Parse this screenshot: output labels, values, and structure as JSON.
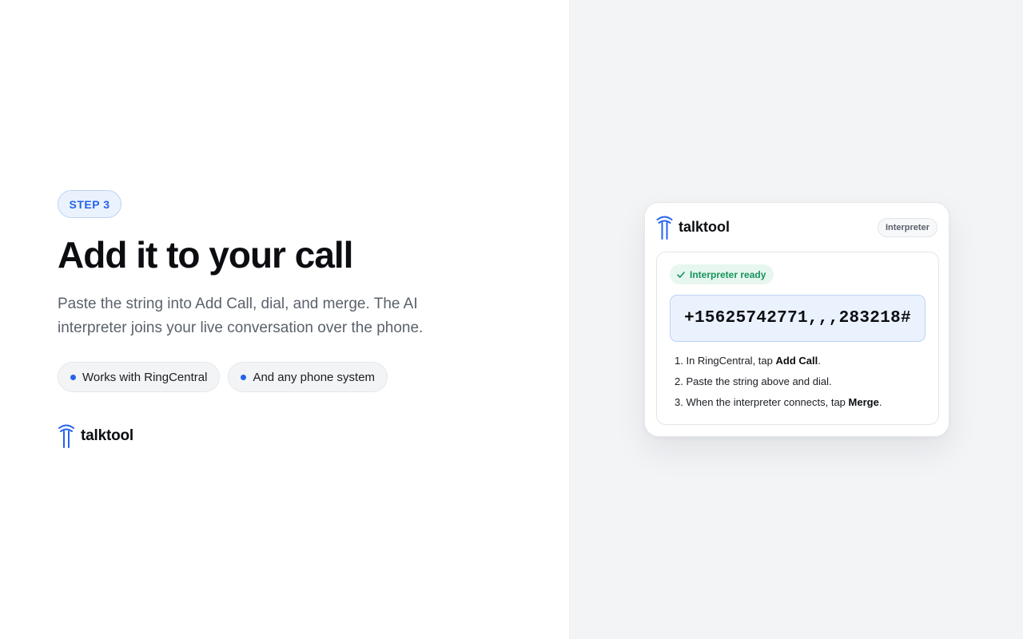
{
  "left": {
    "step_label": "STEP 3",
    "title": "Add it to your call",
    "subtitle": "Paste the string into Add Call, dial, and merge. The AI interpreter joins your live conversation over the phone.",
    "pills": [
      {
        "label": "Works with RingCentral"
      },
      {
        "label": "And any phone system"
      }
    ],
    "brand": "talktool"
  },
  "card": {
    "brand": "talktool",
    "tag": "Interpreter",
    "status": "Interpreter ready",
    "dial_string": "+15625742771,,,283218#",
    "steps": [
      {
        "num": "1.",
        "pre": "In RingCentral, tap ",
        "bold": "Add Call",
        "post": "."
      },
      {
        "num": "2.",
        "pre": "Paste the string above and dial.",
        "bold": "",
        "post": ""
      },
      {
        "num": "3.",
        "pre": "When the interpreter connects, tap ",
        "bold": "Merge",
        "post": "."
      }
    ]
  },
  "colors": {
    "accent": "#2563eb",
    "success": "#16935c",
    "panel_bg": "#f3f4f6"
  },
  "icons": {
    "logo": "talktool-logo-icon",
    "check": "check-icon",
    "bullet": "dot-icon"
  }
}
